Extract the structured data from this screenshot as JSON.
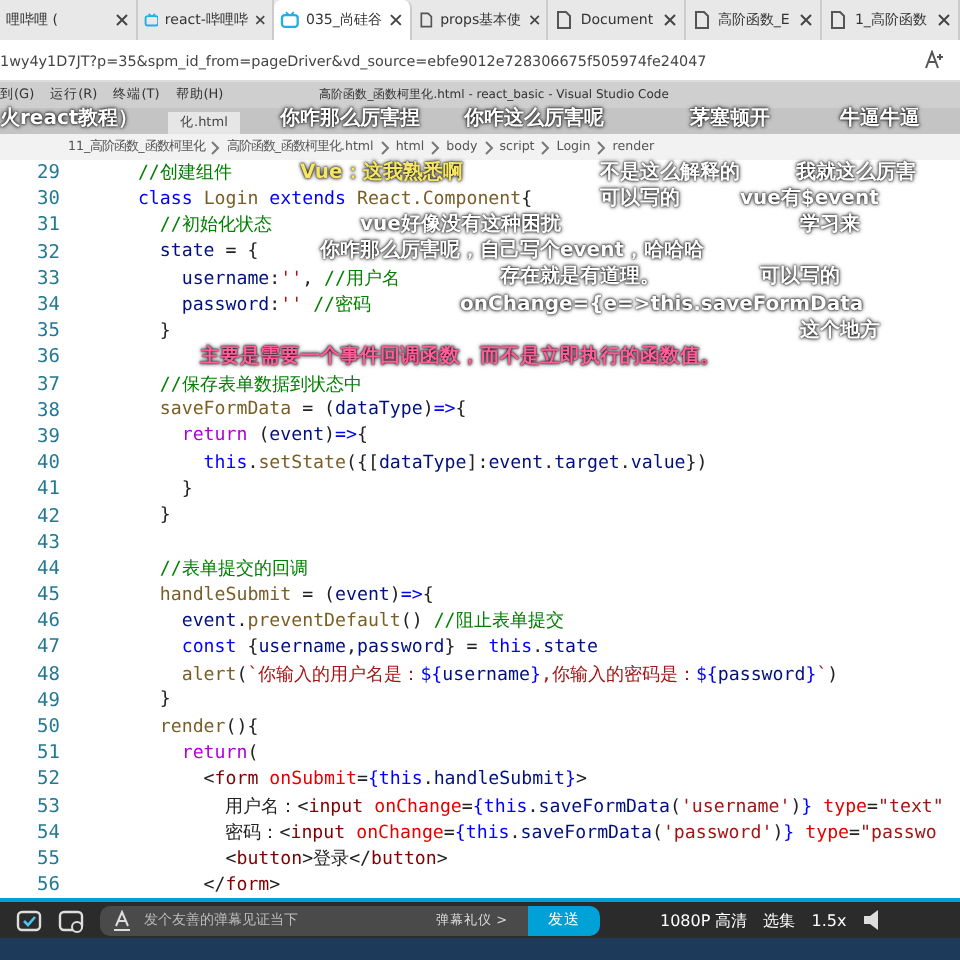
{
  "browser_tabs": [
    {
      "title": "哩哔哩 (",
      "selected": false,
      "kind": "plain"
    },
    {
      "title": "react-哔哩哔",
      "selected": false,
      "kind": "video"
    },
    {
      "title": "035_尚硅谷",
      "selected": true,
      "kind": "video"
    },
    {
      "title": "props基本使",
      "selected": false,
      "kind": "document"
    },
    {
      "title": "Document",
      "selected": false,
      "kind": "document"
    },
    {
      "title": "高阶函数_E",
      "selected": false,
      "kind": "document"
    },
    {
      "title": "1_高阶函数",
      "selected": false,
      "kind": "document"
    }
  ],
  "address_bar": {
    "url": "1wy4y1D7JT?p=35&spm_id_from=pageDriver&vd_source=ebfe9012e728306675f505974fe24047"
  },
  "editor": {
    "menu": [
      "到(G)",
      "运行(R)",
      "终端(T)",
      "帮助(H)"
    ],
    "window_title": "高阶函数_函数柯里化.html - react_basic - Visual Studio Code",
    "file_tab": "化.html",
    "breadcrumb": [
      "11_高阶函数_函数柯里化",
      "高阶函数_函数柯里化.html",
      "html",
      "body",
      "script",
      "Login",
      "render"
    ],
    "lines": [
      {
        "number": "29",
        "segs": [
          {
            "kind": "comment",
            "text": "  //创建组件"
          }
        ]
      },
      {
        "number": "30",
        "segs": [
          {
            "kind": "keyword",
            "text": "  class "
          },
          {
            "kind": "function",
            "text": "Login "
          },
          {
            "kind": "keyword",
            "text": "extends "
          },
          {
            "kind": "function",
            "text": "React.Component"
          },
          {
            "kind": "plain",
            "text": "{"
          }
        ]
      },
      {
        "number": "31",
        "segs": [
          {
            "kind": "comment",
            "text": "    //初始化状态"
          }
        ]
      },
      {
        "number": "32",
        "segs": [
          {
            "kind": "variable",
            "text": "    state "
          },
          {
            "kind": "plain",
            "text": "= {"
          }
        ]
      },
      {
        "number": "33",
        "segs": [
          {
            "kind": "variable",
            "text": "      username"
          },
          {
            "kind": "plain",
            "text": ":"
          },
          {
            "kind": "string",
            "text": "''"
          },
          {
            "kind": "plain",
            "text": ", "
          },
          {
            "kind": "comment",
            "text": "//用户名"
          }
        ]
      },
      {
        "number": "34",
        "segs": [
          {
            "kind": "variable",
            "text": "      password"
          },
          {
            "kind": "plain",
            "text": ":"
          },
          {
            "kind": "string",
            "text": "'' "
          },
          {
            "kind": "comment",
            "text": "//密码"
          }
        ]
      },
      {
        "number": "35",
        "segs": [
          {
            "kind": "plain",
            "text": "    }"
          }
        ]
      },
      {
        "number": "36"
      },
      {
        "number": "37",
        "segs": [
          {
            "kind": "comment",
            "text": "    //保存表单数据到状态中"
          }
        ]
      },
      {
        "number": "38",
        "segs": [
          {
            "kind": "function",
            "text": "    saveFormData "
          },
          {
            "kind": "plain",
            "text": "= ("
          },
          {
            "kind": "variable",
            "text": "dataType"
          },
          {
            "kind": "plain",
            "text": ")"
          },
          {
            "kind": "keyword",
            "text": "=>"
          },
          {
            "kind": "plain",
            "text": "{"
          }
        ]
      },
      {
        "number": "39",
        "segs": [
          {
            "kind": "control",
            "text": "      return "
          },
          {
            "kind": "plain",
            "text": "("
          },
          {
            "kind": "variable",
            "text": "event"
          },
          {
            "kind": "plain",
            "text": ")"
          },
          {
            "kind": "keyword",
            "text": "=>"
          },
          {
            "kind": "plain",
            "text": "{"
          }
        ]
      },
      {
        "number": "40",
        "segs": [
          {
            "kind": "keyword",
            "text": "        this"
          },
          {
            "kind": "plain",
            "text": "."
          },
          {
            "kind": "function",
            "text": "setState"
          },
          {
            "kind": "plain",
            "text": "({["
          },
          {
            "kind": "variable",
            "text": "dataType"
          },
          {
            "kind": "plain",
            "text": "]:"
          },
          {
            "kind": "variable",
            "text": "event"
          },
          {
            "kind": "plain",
            "text": "."
          },
          {
            "kind": "variable",
            "text": "target"
          },
          {
            "kind": "plain",
            "text": "."
          },
          {
            "kind": "variable",
            "text": "value"
          },
          {
            "kind": "plain",
            "text": "})"
          }
        ]
      },
      {
        "number": "41",
        "segs": [
          {
            "kind": "plain",
            "text": "      }"
          }
        ]
      },
      {
        "number": "42",
        "segs": [
          {
            "kind": "plain",
            "text": "    }"
          }
        ]
      },
      {
        "number": "43"
      },
      {
        "number": "44",
        "segs": [
          {
            "kind": "comment",
            "text": "    //表单提交的回调"
          }
        ]
      },
      {
        "number": "45",
        "segs": [
          {
            "kind": "function",
            "text": "    handleSubmit "
          },
          {
            "kind": "plain",
            "text": "= ("
          },
          {
            "kind": "variable",
            "text": "event"
          },
          {
            "kind": "plain",
            "text": ")"
          },
          {
            "kind": "keyword",
            "text": "=>"
          },
          {
            "kind": "plain",
            "text": "{"
          }
        ]
      },
      {
        "number": "46",
        "segs": [
          {
            "kind": "variable",
            "text": "      event"
          },
          {
            "kind": "plain",
            "text": "."
          },
          {
            "kind": "function",
            "text": "preventDefault"
          },
          {
            "kind": "plain",
            "text": "() "
          },
          {
            "kind": "comment",
            "text": "//阻止表单提交"
          }
        ]
      },
      {
        "number": "47",
        "segs": [
          {
            "kind": "keyword",
            "text": "      const "
          },
          {
            "kind": "plain",
            "text": "{"
          },
          {
            "kind": "variable",
            "text": "username"
          },
          {
            "kind": "plain",
            "text": ","
          },
          {
            "kind": "variable",
            "text": "password"
          },
          {
            "kind": "plain",
            "text": "} = "
          },
          {
            "kind": "keyword",
            "text": "this"
          },
          {
            "kind": "plain",
            "text": "."
          },
          {
            "kind": "variable",
            "text": "state"
          }
        ]
      },
      {
        "number": "48",
        "segs": [
          {
            "kind": "function",
            "text": "      alert"
          },
          {
            "kind": "plain",
            "text": "("
          },
          {
            "kind": "string",
            "text": "`你输入的用户名是："
          },
          {
            "kind": "keyword",
            "text": "${"
          },
          {
            "kind": "variable",
            "text": "username"
          },
          {
            "kind": "keyword",
            "text": "}"
          },
          {
            "kind": "string",
            "text": ",你输入的密码是："
          },
          {
            "kind": "keyword",
            "text": "${"
          },
          {
            "kind": "variable",
            "text": "password"
          },
          {
            "kind": "keyword",
            "text": "}"
          },
          {
            "kind": "string",
            "text": "`"
          },
          {
            "kind": "plain",
            "text": ")"
          }
        ]
      },
      {
        "number": "49",
        "segs": [
          {
            "kind": "plain",
            "text": "    }"
          }
        ]
      },
      {
        "number": "50",
        "segs": [
          {
            "kind": "function",
            "text": "    render"
          },
          {
            "kind": "plain",
            "text": "(){"
          }
        ]
      },
      {
        "number": "51",
        "segs": [
          {
            "kind": "control",
            "text": "      return"
          },
          {
            "kind": "plain",
            "text": "("
          }
        ]
      },
      {
        "number": "52",
        "segs": [
          {
            "kind": "plain",
            "text": "        <"
          },
          {
            "kind": "tag",
            "text": "form "
          },
          {
            "kind": "attribute",
            "text": "onSubmit"
          },
          {
            "kind": "plain",
            "text": "="
          },
          {
            "kind": "keyword",
            "text": "{this"
          },
          {
            "kind": "plain",
            "text": "."
          },
          {
            "kind": "variable",
            "text": "handleSubmit"
          },
          {
            "kind": "keyword",
            "text": "}"
          },
          {
            "kind": "plain",
            "text": ">"
          }
        ]
      },
      {
        "number": "53",
        "segs": [
          {
            "kind": "plain",
            "text": "          用户名：<"
          },
          {
            "kind": "tag",
            "text": "input "
          },
          {
            "kind": "attribute",
            "text": "onChange"
          },
          {
            "kind": "plain",
            "text": "="
          },
          {
            "kind": "keyword",
            "text": "{this"
          },
          {
            "kind": "plain",
            "text": "."
          },
          {
            "kind": "variable",
            "text": "saveFormData"
          },
          {
            "kind": "plain",
            "text": "("
          },
          {
            "kind": "string",
            "text": "'username'"
          },
          {
            "kind": "plain",
            "text": ")"
          },
          {
            "kind": "keyword",
            "text": "} "
          },
          {
            "kind": "attribute",
            "text": "type"
          },
          {
            "kind": "plain",
            "text": "="
          },
          {
            "kind": "string",
            "text": "\"text\""
          }
        ]
      },
      {
        "number": "54",
        "segs": [
          {
            "kind": "plain",
            "text": "          密码：<"
          },
          {
            "kind": "tag",
            "text": "input "
          },
          {
            "kind": "attribute",
            "text": "onChange"
          },
          {
            "kind": "plain",
            "text": "="
          },
          {
            "kind": "keyword",
            "text": "{this"
          },
          {
            "kind": "plain",
            "text": "."
          },
          {
            "kind": "variable",
            "text": "saveFormData"
          },
          {
            "kind": "plain",
            "text": "("
          },
          {
            "kind": "string",
            "text": "'password'"
          },
          {
            "kind": "plain",
            "text": ")"
          },
          {
            "kind": "keyword",
            "text": "} "
          },
          {
            "kind": "attribute",
            "text": "type"
          },
          {
            "kind": "plain",
            "text": "="
          },
          {
            "kind": "string",
            "text": "\"passwo"
          }
        ]
      },
      {
        "number": "55",
        "segs": [
          {
            "kind": "plain",
            "text": "          <"
          },
          {
            "kind": "tag",
            "text": "button"
          },
          {
            "kind": "plain",
            "text": ">登录</"
          },
          {
            "kind": "tag",
            "text": "button"
          },
          {
            "kind": "plain",
            "text": ">"
          }
        ]
      },
      {
        "number": "56",
        "segs": [
          {
            "kind": "plain",
            "text": "        </"
          },
          {
            "kind": "tag",
            "text": "form"
          },
          {
            "kind": "plain",
            "text": ">"
          }
        ]
      }
    ]
  },
  "danmaku": [
    {
      "text": "火react教程）",
      "color": "#ffffff"
    },
    {
      "text": "你咋那么厉害捏",
      "color": "#ffffff"
    },
    {
      "text": "你咋这么厉害呢",
      "color": "#ffffff"
    },
    {
      "text": "茅塞顿开",
      "color": "#ffffff"
    },
    {
      "text": "牛逼牛逼",
      "color": "#ffffff"
    },
    {
      "text": "Vue：这我熟悉啊",
      "color": "#f5e663"
    },
    {
      "text": "不是这么解释的",
      "color": "#ffffff"
    },
    {
      "text": "我就这么厉害",
      "color": "#ffffff"
    },
    {
      "text": "可以写的",
      "color": "#ffffff"
    },
    {
      "text": "vue有$event",
      "color": "#ffffff"
    },
    {
      "text": "vue好像没有这种困扰",
      "color": "#ffffff"
    },
    {
      "text": "学习来",
      "color": "#ffffff"
    },
    {
      "text": "你咋那么厉害呢，自己写个event，哈哈哈",
      "color": "#ffffff"
    },
    {
      "text": "存在就是有道理。",
      "color": "#ffffff"
    },
    {
      "text": "可以写的",
      "color": "#ffffff"
    },
    {
      "text": "onChange={e=>this.saveFormData",
      "color": "#ffffff"
    },
    {
      "text": "这个地方",
      "color": "#ffffff"
    },
    {
      "text": "主要是需要一个事件回调函数，而不是立即执行的函数值。",
      "color": "#ff5c9a"
    }
  ],
  "player": {
    "danmaku_input": {
      "placeholder": "发个友善的弹幕见证当下"
    },
    "etiquette_link": "弹幕礼仪 >",
    "send_button": "发送",
    "quality": "1080P 高清",
    "episodes": "选集",
    "speed": "1.5x"
  }
}
